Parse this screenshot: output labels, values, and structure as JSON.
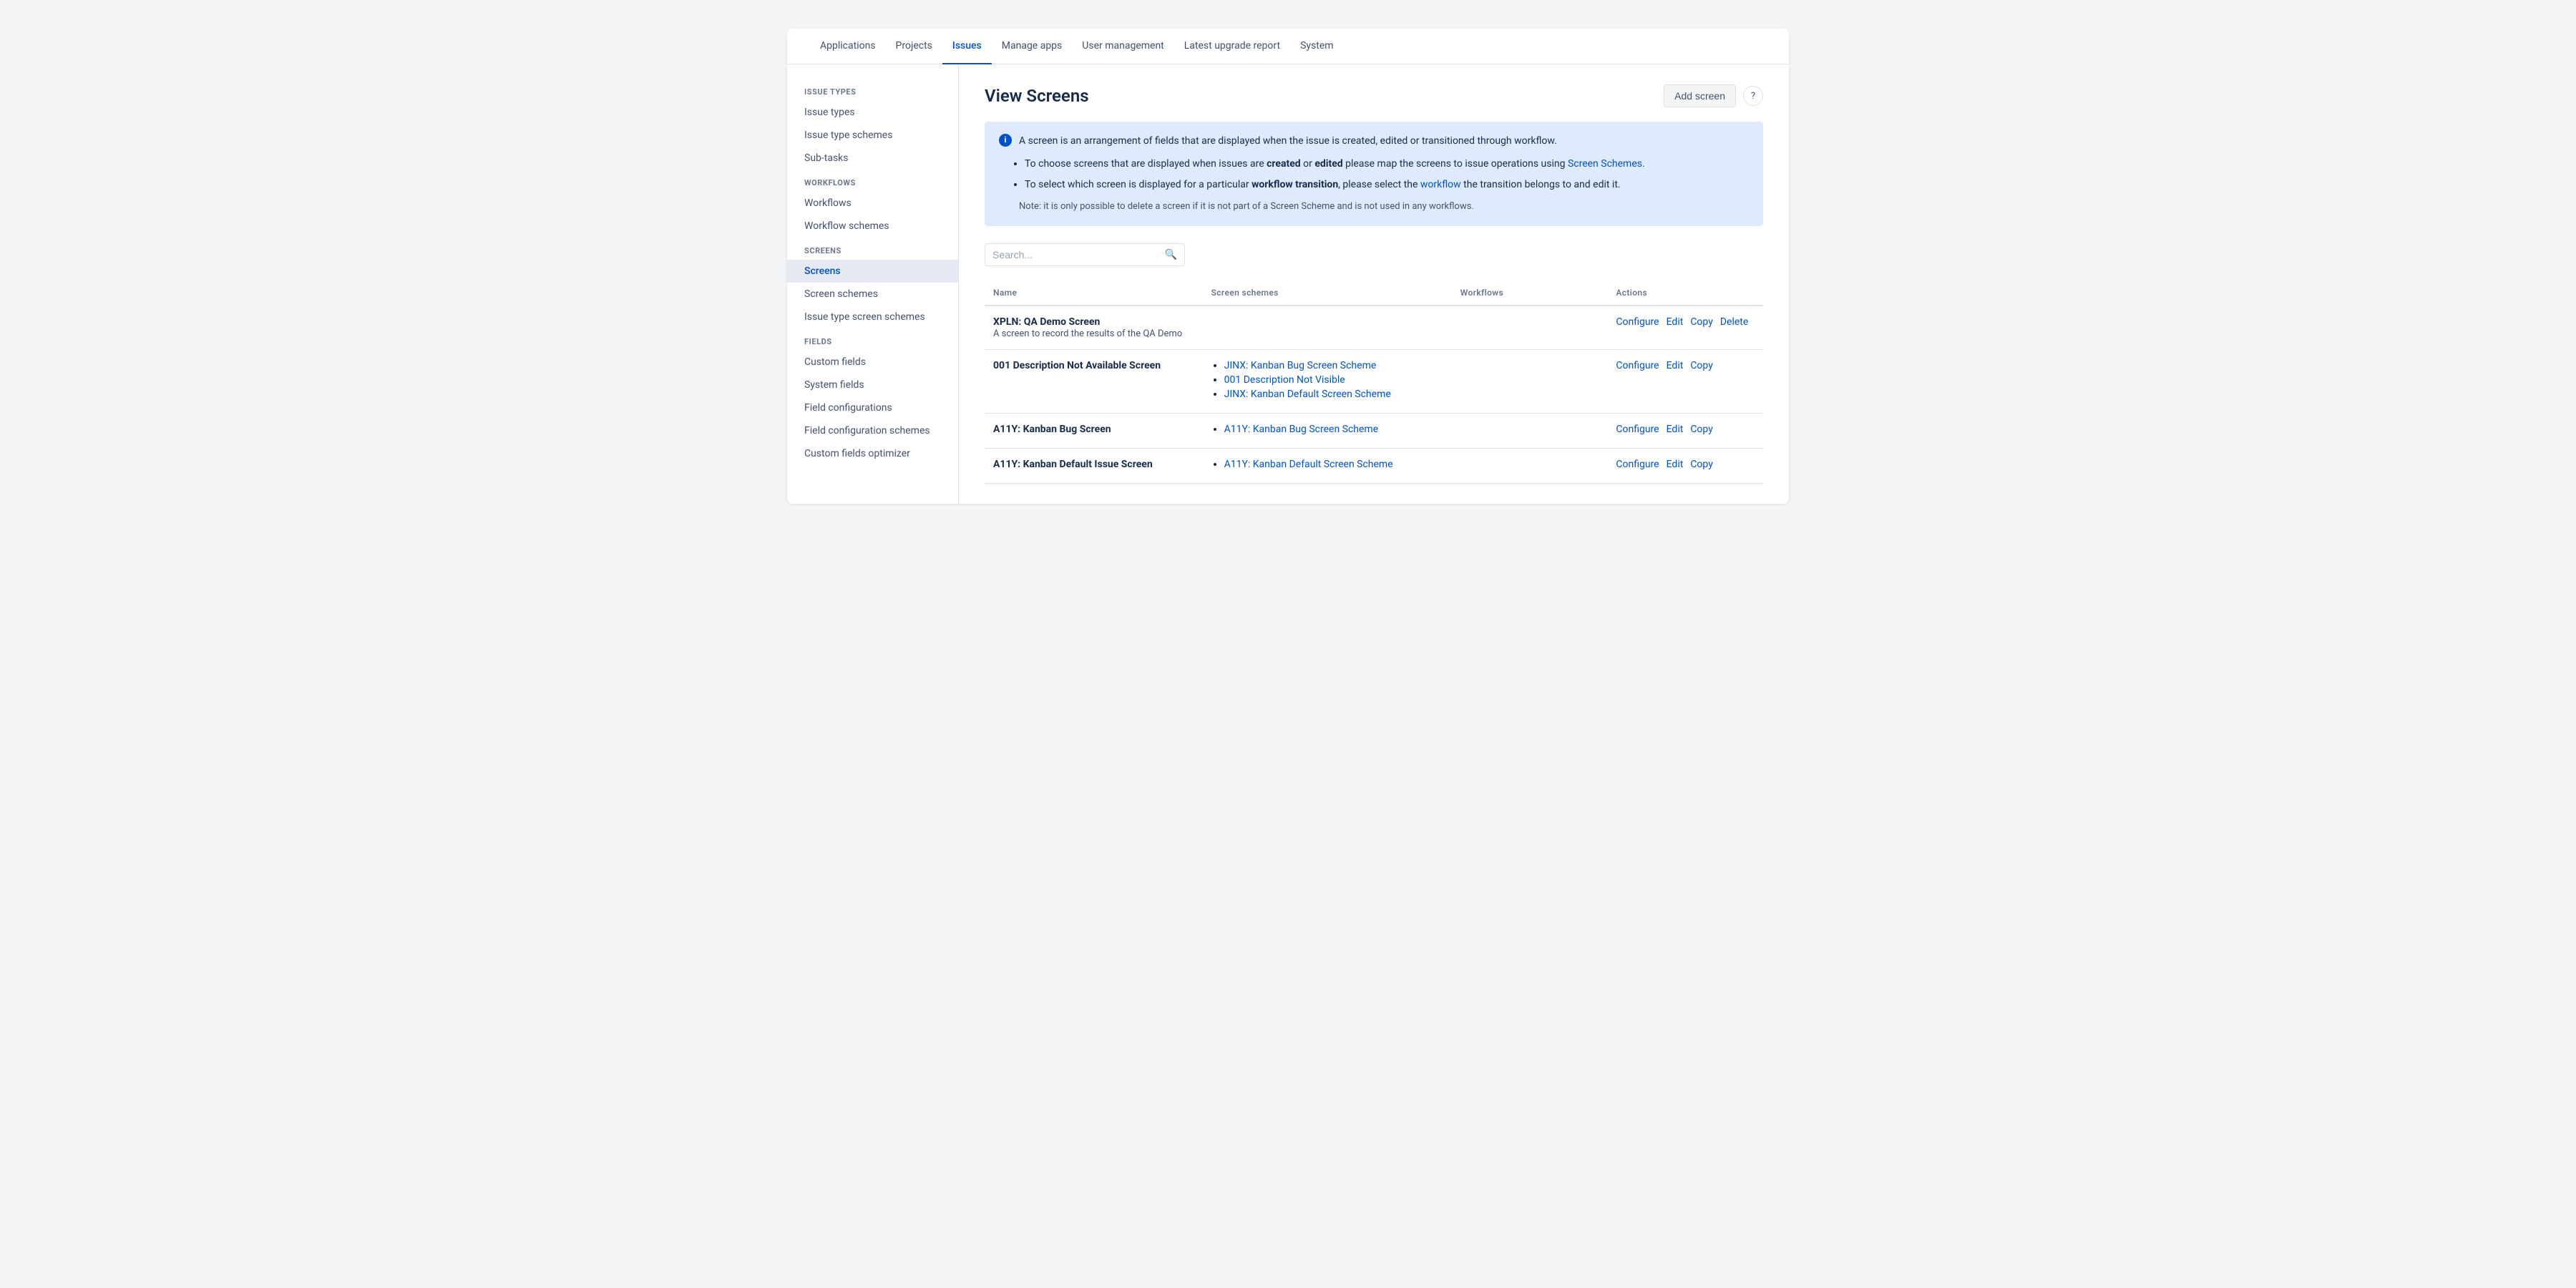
{
  "topNav": {
    "items": [
      {
        "id": "applications",
        "label": "Applications",
        "active": false
      },
      {
        "id": "projects",
        "label": "Projects",
        "active": false
      },
      {
        "id": "issues",
        "label": "Issues",
        "active": true
      },
      {
        "id": "manage-apps",
        "label": "Manage apps",
        "active": false
      },
      {
        "id": "user-management",
        "label": "User management",
        "active": false
      },
      {
        "id": "latest-upgrade-report",
        "label": "Latest upgrade report",
        "active": false
      },
      {
        "id": "system",
        "label": "System",
        "active": false
      }
    ]
  },
  "sidebar": {
    "sections": [
      {
        "id": "issue-types",
        "label": "Issue Types",
        "items": [
          {
            "id": "issue-types",
            "label": "Issue types",
            "active": false
          },
          {
            "id": "issue-type-schemes",
            "label": "Issue type schemes",
            "active": false
          },
          {
            "id": "sub-tasks",
            "label": "Sub-tasks",
            "active": false
          }
        ]
      },
      {
        "id": "workflows",
        "label": "Workflows",
        "items": [
          {
            "id": "workflows",
            "label": "Workflows",
            "active": false
          },
          {
            "id": "workflow-schemes",
            "label": "Workflow schemes",
            "active": false
          }
        ]
      },
      {
        "id": "screens",
        "label": "Screens",
        "items": [
          {
            "id": "screens",
            "label": "Screens",
            "active": true
          },
          {
            "id": "screen-schemes",
            "label": "Screen schemes",
            "active": false
          },
          {
            "id": "issue-type-screen-schemes",
            "label": "Issue type screen schemes",
            "active": false
          }
        ]
      },
      {
        "id": "fields",
        "label": "Fields",
        "items": [
          {
            "id": "custom-fields",
            "label": "Custom fields",
            "active": false
          },
          {
            "id": "system-fields",
            "label": "System fields",
            "active": false
          },
          {
            "id": "field-configurations",
            "label": "Field configurations",
            "active": false
          },
          {
            "id": "field-configuration-schemes",
            "label": "Field configuration schemes",
            "active": false
          },
          {
            "id": "custom-fields-optimizer",
            "label": "Custom fields optimizer",
            "active": false
          }
        ]
      }
    ]
  },
  "content": {
    "title": "View Screens",
    "addScreenButton": "Add screen",
    "helpTooltip": "?",
    "infoBox": {
      "mainText": "A screen is an arrangement of fields that are displayed when the issue is created, edited or transitioned through workflow.",
      "bullets": [
        {
          "text": "To choose screens that are displayed when issues are ",
          "boldParts": [
            "created",
            "edited"
          ],
          "suffix": " please map the screens to issue operations using ",
          "linkText": "Screen Schemes",
          "linkHref": "#",
          "afterLink": "."
        },
        {
          "text": "To select which screen is displayed for a particular ",
          "boldPart": "workflow transition",
          "suffix": ", please select the ",
          "linkText": "workflow",
          "linkHref": "#",
          "afterLink": " the transition belongs to and edit it."
        }
      ],
      "note": "Note: it is only possible to delete a screen if it is not part of a Screen Scheme and is not used in any workflows."
    },
    "search": {
      "placeholder": "Search..."
    },
    "table": {
      "columns": [
        {
          "id": "name",
          "label": "Name"
        },
        {
          "id": "screen-schemes",
          "label": "Screen schemes"
        },
        {
          "id": "workflows",
          "label": "Workflows"
        },
        {
          "id": "actions",
          "label": "Actions"
        }
      ],
      "rows": [
        {
          "id": "xpln-qa-demo",
          "name": "XPLN: QA Demo Screen",
          "description": "A screen to record the results of the QA Demo",
          "screenSchemes": [],
          "workflows": [],
          "actions": [
            "Configure",
            "Edit",
            "Copy",
            "Delete"
          ]
        },
        {
          "id": "001-description-not-available",
          "name": "001 Description Not Available Screen",
          "description": "",
          "screenSchemes": [
            {
              "label": "JINX: Kanban Bug Screen Scheme",
              "href": "#"
            },
            {
              "label": "001 Description Not Visible",
              "href": "#"
            },
            {
              "label": "JINX: Kanban Default Screen Scheme",
              "href": "#"
            }
          ],
          "workflows": [],
          "actions": [
            "Configure",
            "Edit",
            "Copy"
          ]
        },
        {
          "id": "a11y-kanban-bug",
          "name": "A11Y: Kanban Bug Screen",
          "description": "",
          "screenSchemes": [
            {
              "label": "A11Y: Kanban Bug Screen Scheme",
              "href": "#"
            }
          ],
          "workflows": [],
          "actions": [
            "Configure",
            "Edit",
            "Copy"
          ]
        },
        {
          "id": "a11y-kanban-default",
          "name": "A11Y: Kanban Default Issue Screen",
          "description": "",
          "screenSchemes": [
            {
              "label": "A11Y: Kanban Default Screen Scheme",
              "href": "#"
            }
          ],
          "workflows": [],
          "actions": [
            "Configure",
            "Edit",
            "Copy"
          ]
        }
      ]
    }
  }
}
